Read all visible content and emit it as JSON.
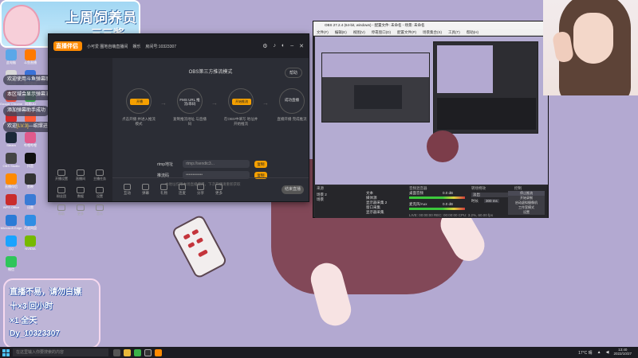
{
  "banner": {
    "title": "上周饲养员",
    "name": "三三酱"
  },
  "chat": [
    {
      "text": "欢迎使用斗鱼弹幕助手"
    },
    {
      "text": "本区域会显示弹幕消息和礼物消息"
    },
    {
      "text": "添加弹幕助手成功"
    },
    {
      "prefix": "欢迎",
      "user": "[LV.3]",
      "suffix": "—绾熠进入直播间"
    }
  ],
  "desktop_icons_left": [
    "此电脑",
    "回收站",
    "Google Chrome",
    "网易云音乐",
    "Steam",
    "OBS Studio",
    "直播伴侣",
    "WPS Office",
    "Microsoft Edge",
    "QQ",
    "微信"
  ],
  "desktop_icons_right": [
    "斗鱼直播",
    "腾讯会议",
    "网易UU",
    "WeGame",
    "哔哩哔哩",
    "抖音",
    "剪映",
    "迅雷",
    "百度网盘",
    "NVIDIA"
  ],
  "app": {
    "logo": "直播伴侣",
    "room": "小可爱 圈地自萌直播间",
    "room_tag": "娱乐",
    "room_id": "房间号:10323307",
    "obs_mode_title": "OBS第三方推流模式",
    "help": "帮助",
    "steps": [
      {
        "inside": "开播",
        "label": "点击开播 并进入推流模式"
      },
      {
        "inside": "FMS URL\n推流/串码",
        "label": "复制推流地址 与直播码"
      },
      {
        "inside": "开始推流",
        "label": "在OBS中填写 地址并开始推流"
      },
      {
        "inside": "成功直播",
        "label": "直播开播 完成推流"
      }
    ],
    "rtmp_label": "rtmp地址",
    "rtmp_value": "rtmp://sendtc3...",
    "key_label": "推流码",
    "key_value": "••••••••••••",
    "copy_label": "复制",
    "note": "本地址仅限本场直播使用，下次开播请重新获取",
    "bottom_items": [
      "互动",
      "弹幕",
      "礼物",
      "连麦",
      "分享",
      "更多"
    ],
    "go_live": "结束直播",
    "side_items": [
      "开播设置",
      "直播间",
      "主播任务",
      "粉丝团",
      "数据",
      "设置",
      "帮助",
      "更多",
      "音乐"
    ]
  },
  "obs": {
    "title": "OBS 27.2.4 (64-bit, windows) - 配置文件: 未命名 - 场景: 未命名",
    "menu": [
      "文件(F)",
      "编辑(E)",
      "视图(V)",
      "停靠窗口(D)",
      "配置文件(P)",
      "场景集合(S)",
      "工具(T)",
      "帮助(H)"
    ],
    "scenes_title": "来源",
    "scenes": [
      "场景 2",
      "场景"
    ],
    "sources": [
      "文本",
      "媒体源",
      "显示器采集 2",
      "窗口采集",
      "显示器采集"
    ],
    "mixer_title": "音频混音器",
    "mixer": [
      {
        "name": "桌面音频",
        "db": "0.0 dB"
      },
      {
        "name": "麦克风/Aux",
        "db": "0.0 dB"
      }
    ],
    "transition_title": "转场特效",
    "transition_value": "淡出",
    "duration_label": "时长",
    "duration_value": "300 ms",
    "controls_title": "控制",
    "controls": [
      "停止推流",
      "开始录制",
      "启动虚拟摄像机",
      "工作室模式",
      "设置",
      "退出"
    ],
    "status": "LIVE: 00:00:00  REC: 00:00:00  CPU: 3.2%, 60.00 fps"
  },
  "info": {
    "line1": "直播不易，请勿白嫖",
    "line2": "十×3 回小时",
    "line3": "×1 全天",
    "line4": "Dy_10323307"
  },
  "taskbar": {
    "search": "在这里输入你要搜索的内容",
    "weather": "17°C 晴",
    "time": "13:40",
    "date": "2022/10/27"
  }
}
